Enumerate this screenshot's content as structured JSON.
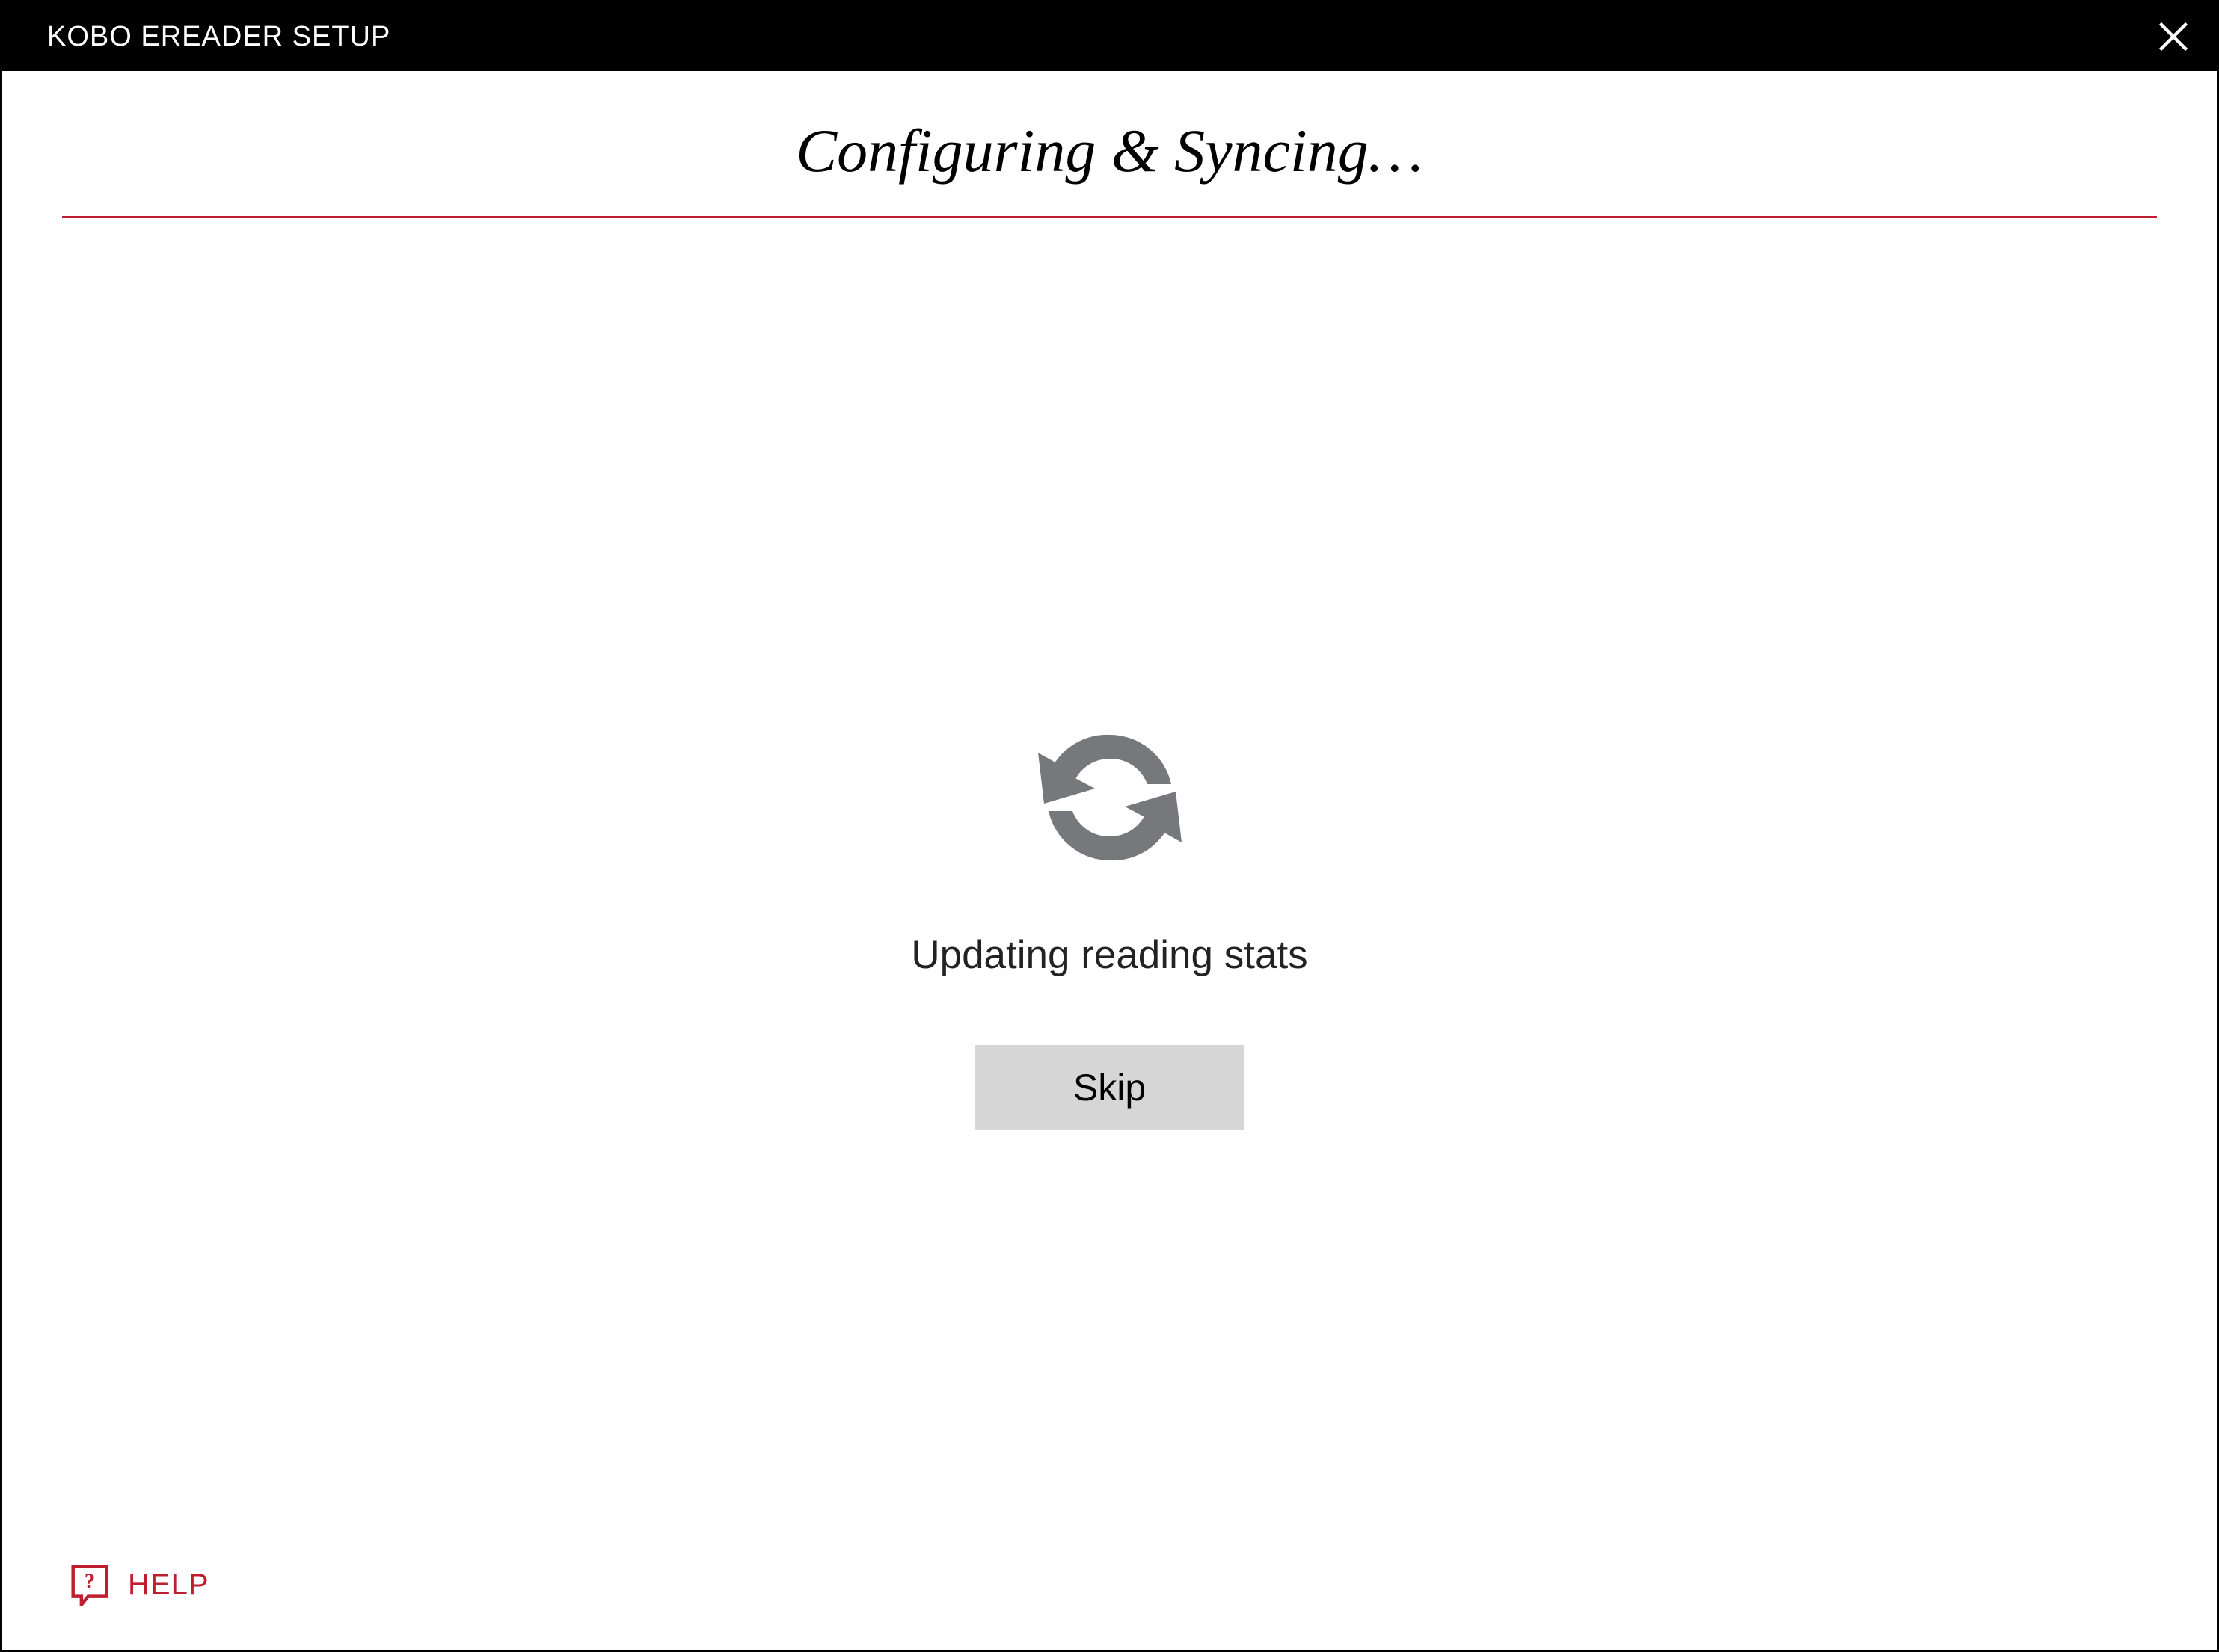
{
  "window": {
    "title": "KOBO EREADER SETUP"
  },
  "heading": "Configuring & Syncing…",
  "status_text": "Updating reading stats",
  "skip_button_label": "Skip",
  "help": {
    "label": "HELP"
  },
  "colors": {
    "accent_red": "#be1e2d",
    "titlebar_bg": "#000000",
    "titlebar_fg": "#ffffff",
    "button_bg": "#d6d6d6",
    "spinner_gray": "#77787b"
  }
}
